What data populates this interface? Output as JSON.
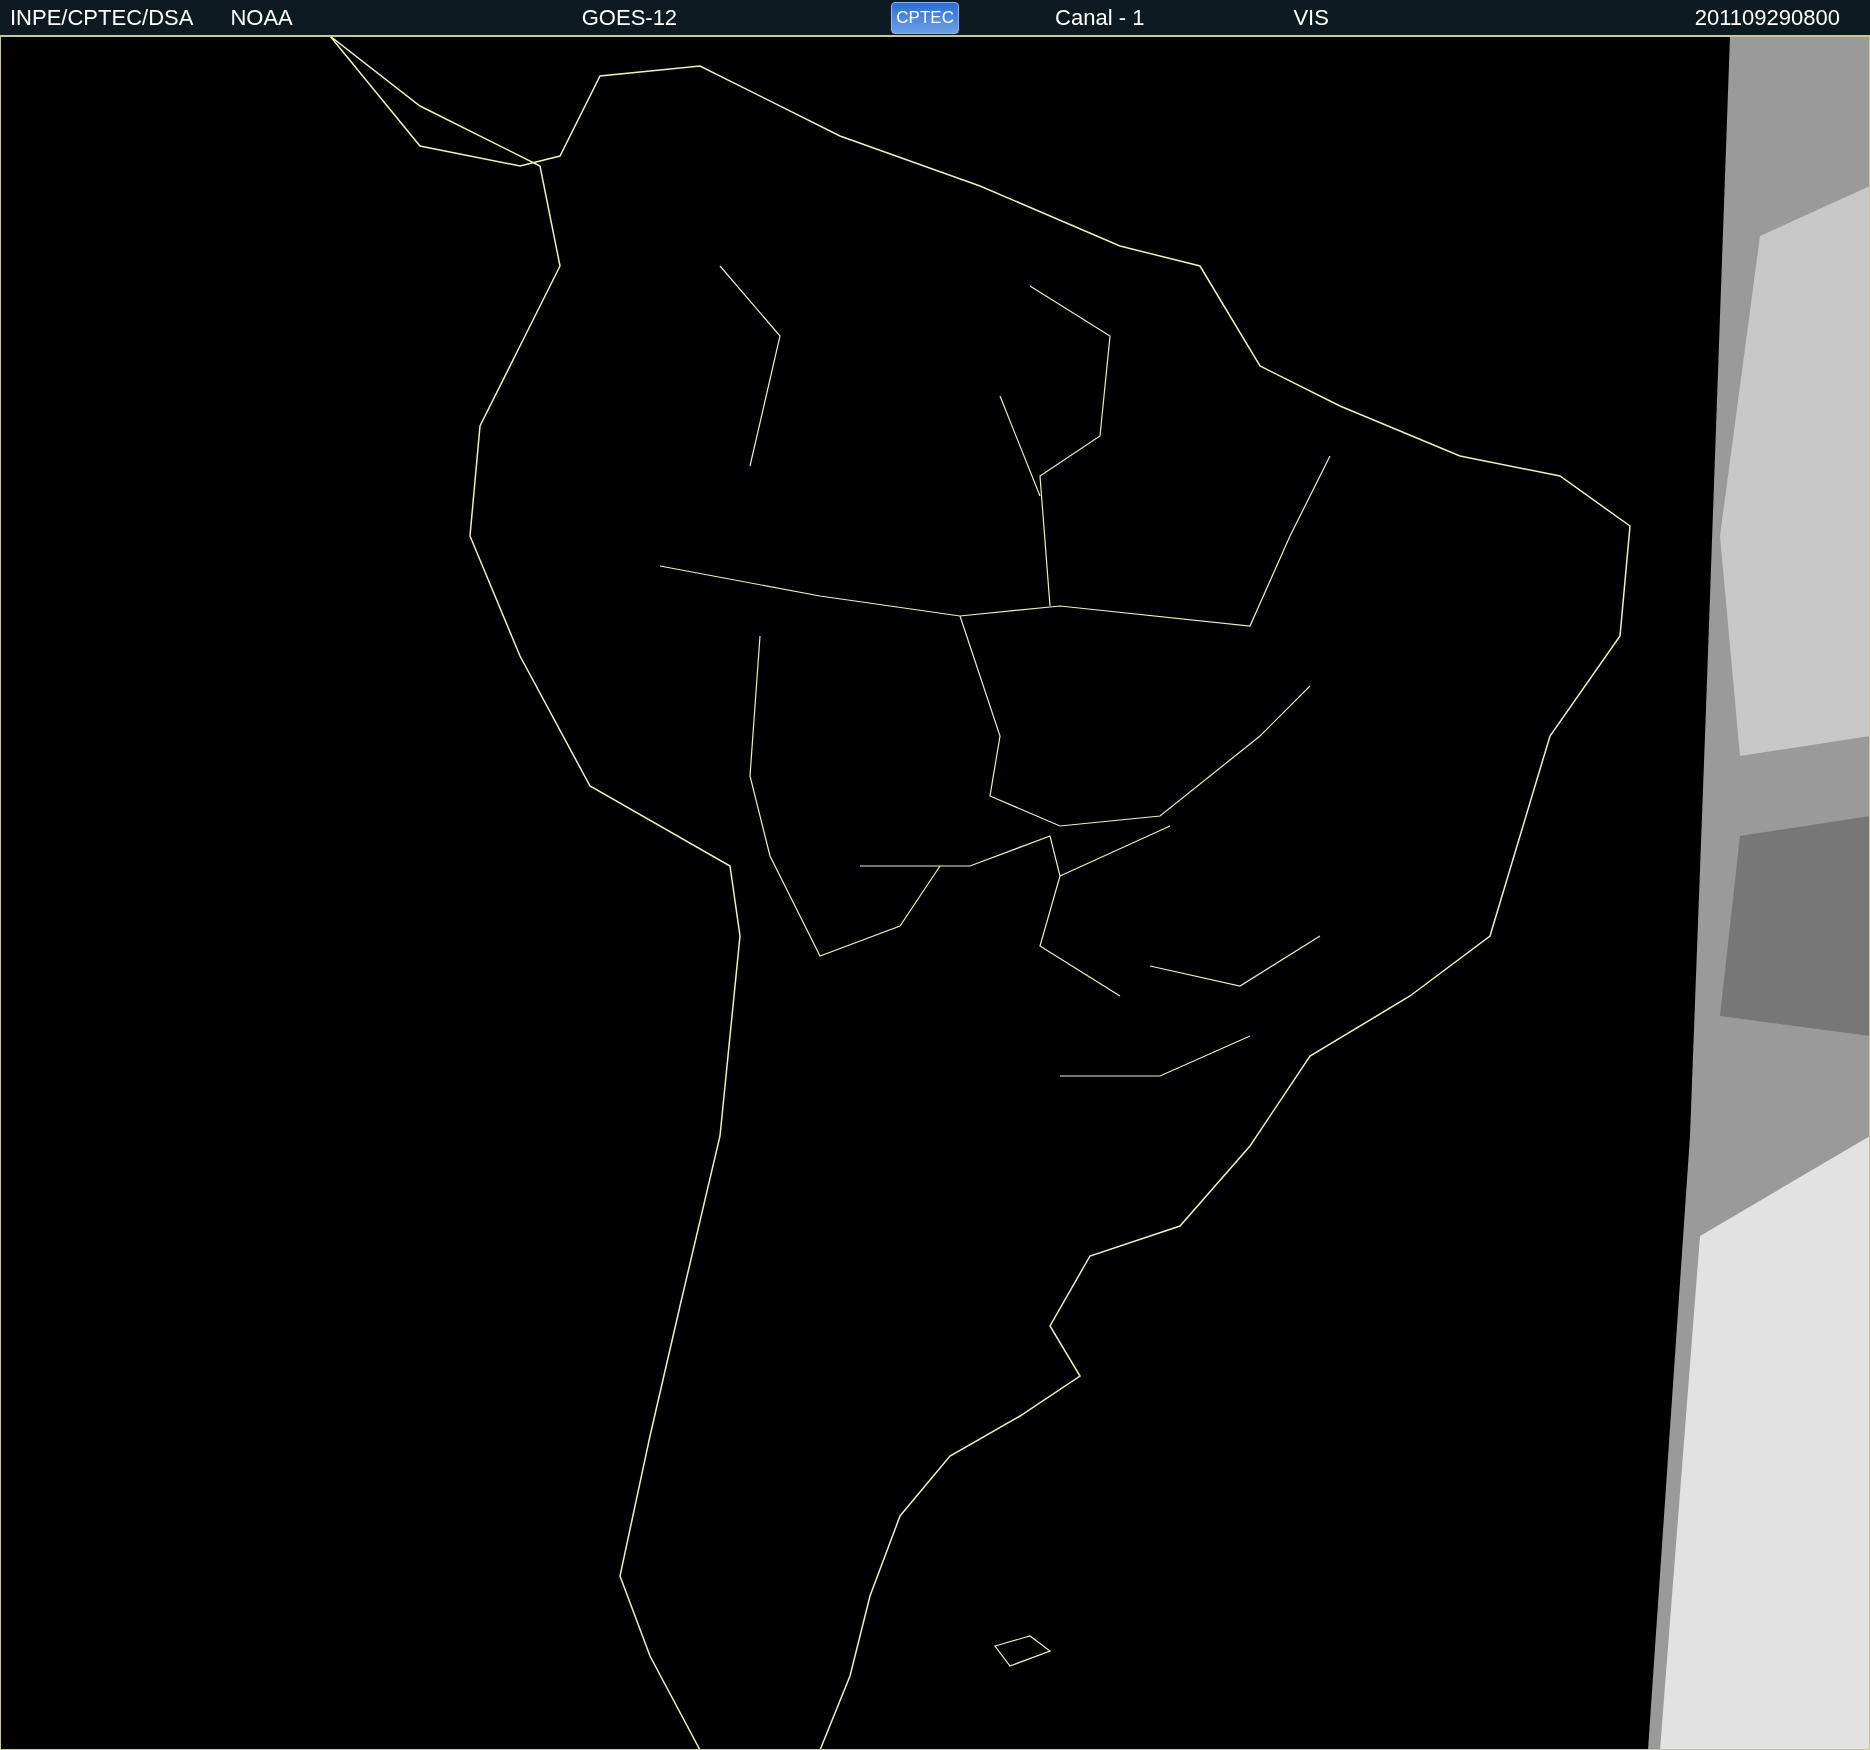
{
  "header": {
    "source": "INPE/CPTEC/DSA",
    "agency": "NOAA",
    "satellite": "GOES-12",
    "logo": "CPTEC",
    "channel": "Canal - 1",
    "band": "VIS",
    "timestamp": "201109290800"
  }
}
